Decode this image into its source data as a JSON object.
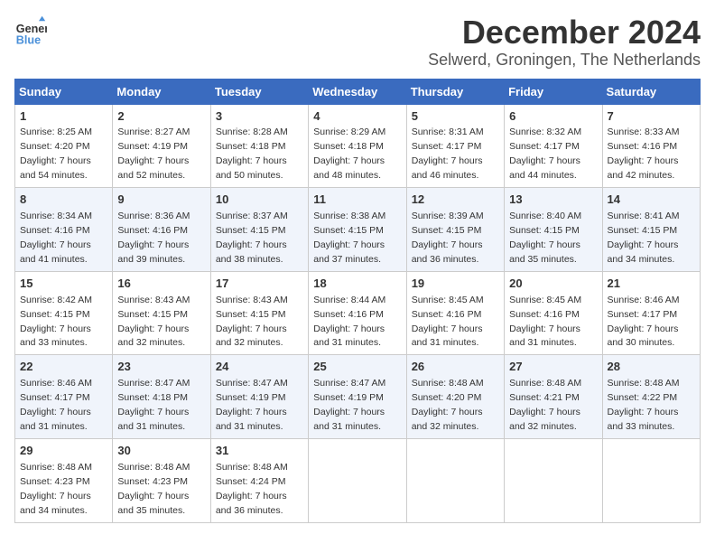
{
  "logo": {
    "line1": "General",
    "line2": "Blue"
  },
  "title": "December 2024",
  "location": "Selwerd, Groningen, The Netherlands",
  "days_of_week": [
    "Sunday",
    "Monday",
    "Tuesday",
    "Wednesday",
    "Thursday",
    "Friday",
    "Saturday"
  ],
  "weeks": [
    [
      {
        "day": 1,
        "sunrise": "8:25 AM",
        "sunset": "4:20 PM",
        "daylight": "7 hours and 54 minutes."
      },
      {
        "day": 2,
        "sunrise": "8:27 AM",
        "sunset": "4:19 PM",
        "daylight": "7 hours and 52 minutes."
      },
      {
        "day": 3,
        "sunrise": "8:28 AM",
        "sunset": "4:18 PM",
        "daylight": "7 hours and 50 minutes."
      },
      {
        "day": 4,
        "sunrise": "8:29 AM",
        "sunset": "4:18 PM",
        "daylight": "7 hours and 48 minutes."
      },
      {
        "day": 5,
        "sunrise": "8:31 AM",
        "sunset": "4:17 PM",
        "daylight": "7 hours and 46 minutes."
      },
      {
        "day": 6,
        "sunrise": "8:32 AM",
        "sunset": "4:17 PM",
        "daylight": "7 hours and 44 minutes."
      },
      {
        "day": 7,
        "sunrise": "8:33 AM",
        "sunset": "4:16 PM",
        "daylight": "7 hours and 42 minutes."
      }
    ],
    [
      {
        "day": 8,
        "sunrise": "8:34 AM",
        "sunset": "4:16 PM",
        "daylight": "7 hours and 41 minutes."
      },
      {
        "day": 9,
        "sunrise": "8:36 AM",
        "sunset": "4:16 PM",
        "daylight": "7 hours and 39 minutes."
      },
      {
        "day": 10,
        "sunrise": "8:37 AM",
        "sunset": "4:15 PM",
        "daylight": "7 hours and 38 minutes."
      },
      {
        "day": 11,
        "sunrise": "8:38 AM",
        "sunset": "4:15 PM",
        "daylight": "7 hours and 37 minutes."
      },
      {
        "day": 12,
        "sunrise": "8:39 AM",
        "sunset": "4:15 PM",
        "daylight": "7 hours and 36 minutes."
      },
      {
        "day": 13,
        "sunrise": "8:40 AM",
        "sunset": "4:15 PM",
        "daylight": "7 hours and 35 minutes."
      },
      {
        "day": 14,
        "sunrise": "8:41 AM",
        "sunset": "4:15 PM",
        "daylight": "7 hours and 34 minutes."
      }
    ],
    [
      {
        "day": 15,
        "sunrise": "8:42 AM",
        "sunset": "4:15 PM",
        "daylight": "7 hours and 33 minutes."
      },
      {
        "day": 16,
        "sunrise": "8:43 AM",
        "sunset": "4:15 PM",
        "daylight": "7 hours and 32 minutes."
      },
      {
        "day": 17,
        "sunrise": "8:43 AM",
        "sunset": "4:15 PM",
        "daylight": "7 hours and 32 minutes."
      },
      {
        "day": 18,
        "sunrise": "8:44 AM",
        "sunset": "4:16 PM",
        "daylight": "7 hours and 31 minutes."
      },
      {
        "day": 19,
        "sunrise": "8:45 AM",
        "sunset": "4:16 PM",
        "daylight": "7 hours and 31 minutes."
      },
      {
        "day": 20,
        "sunrise": "8:45 AM",
        "sunset": "4:16 PM",
        "daylight": "7 hours and 31 minutes."
      },
      {
        "day": 21,
        "sunrise": "8:46 AM",
        "sunset": "4:17 PM",
        "daylight": "7 hours and 30 minutes."
      }
    ],
    [
      {
        "day": 22,
        "sunrise": "8:46 AM",
        "sunset": "4:17 PM",
        "daylight": "7 hours and 31 minutes."
      },
      {
        "day": 23,
        "sunrise": "8:47 AM",
        "sunset": "4:18 PM",
        "daylight": "7 hours and 31 minutes."
      },
      {
        "day": 24,
        "sunrise": "8:47 AM",
        "sunset": "4:19 PM",
        "daylight": "7 hours and 31 minutes."
      },
      {
        "day": 25,
        "sunrise": "8:47 AM",
        "sunset": "4:19 PM",
        "daylight": "7 hours and 31 minutes."
      },
      {
        "day": 26,
        "sunrise": "8:48 AM",
        "sunset": "4:20 PM",
        "daylight": "7 hours and 32 minutes."
      },
      {
        "day": 27,
        "sunrise": "8:48 AM",
        "sunset": "4:21 PM",
        "daylight": "7 hours and 32 minutes."
      },
      {
        "day": 28,
        "sunrise": "8:48 AM",
        "sunset": "4:22 PM",
        "daylight": "7 hours and 33 minutes."
      }
    ],
    [
      {
        "day": 29,
        "sunrise": "8:48 AM",
        "sunset": "4:23 PM",
        "daylight": "7 hours and 34 minutes."
      },
      {
        "day": 30,
        "sunrise": "8:48 AM",
        "sunset": "4:23 PM",
        "daylight": "7 hours and 35 minutes."
      },
      {
        "day": 31,
        "sunrise": "8:48 AM",
        "sunset": "4:24 PM",
        "daylight": "7 hours and 36 minutes."
      },
      null,
      null,
      null,
      null
    ]
  ]
}
